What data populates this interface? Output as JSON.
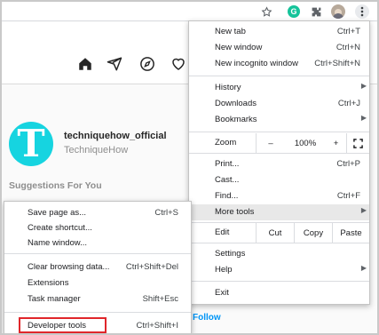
{
  "toolbar": {
    "icons": [
      "star-icon",
      "grammarly-icon",
      "extensions-icon",
      "avatar",
      "menu-dots-icon"
    ],
    "grammarly_letter": "G"
  },
  "page": {
    "nav_icons": [
      "home-icon",
      "direct-icon",
      "explore-icon",
      "heart-icon"
    ],
    "avatar_letter": "T",
    "username": "techniquehow_official",
    "full_name": "TechniqueHow",
    "suggestions_title": "Suggestions For You",
    "follow_label": "Follow"
  },
  "menu": {
    "new_tab": {
      "label": "New tab",
      "shortcut": "Ctrl+T"
    },
    "new_window": {
      "label": "New window",
      "shortcut": "Ctrl+N"
    },
    "new_incognito": {
      "label": "New incognito window",
      "shortcut": "Ctrl+Shift+N"
    },
    "history": {
      "label": "History"
    },
    "downloads": {
      "label": "Downloads",
      "shortcut": "Ctrl+J"
    },
    "bookmarks": {
      "label": "Bookmarks"
    },
    "zoom": {
      "label": "Zoom",
      "minus": "–",
      "value": "100%",
      "plus": "+"
    },
    "print": {
      "label": "Print...",
      "shortcut": "Ctrl+P"
    },
    "cast": {
      "label": "Cast..."
    },
    "find": {
      "label": "Find...",
      "shortcut": "Ctrl+F"
    },
    "more_tools": {
      "label": "More tools"
    },
    "edit": {
      "label": "Edit",
      "cut": "Cut",
      "copy": "Copy",
      "paste": "Paste"
    },
    "settings": {
      "label": "Settings"
    },
    "help": {
      "label": "Help"
    },
    "exit": {
      "label": "Exit"
    }
  },
  "submenu": {
    "save_page": {
      "label": "Save page as...",
      "shortcut": "Ctrl+S"
    },
    "create_shortcut": {
      "label": "Create shortcut..."
    },
    "name_window": {
      "label": "Name window..."
    },
    "clear_data": {
      "label": "Clear browsing data...",
      "shortcut": "Ctrl+Shift+Del"
    },
    "extensions": {
      "label": "Extensions"
    },
    "task_manager": {
      "label": "Task manager",
      "shortcut": "Shift+Esc"
    },
    "developer_tools": {
      "label": "Developer tools",
      "shortcut": "Ctrl+Shift+I"
    }
  },
  "colors": {
    "highlight_box": "#e0262b",
    "instagram_link": "#0095f6",
    "avatar_bg": "#16d4e0"
  }
}
